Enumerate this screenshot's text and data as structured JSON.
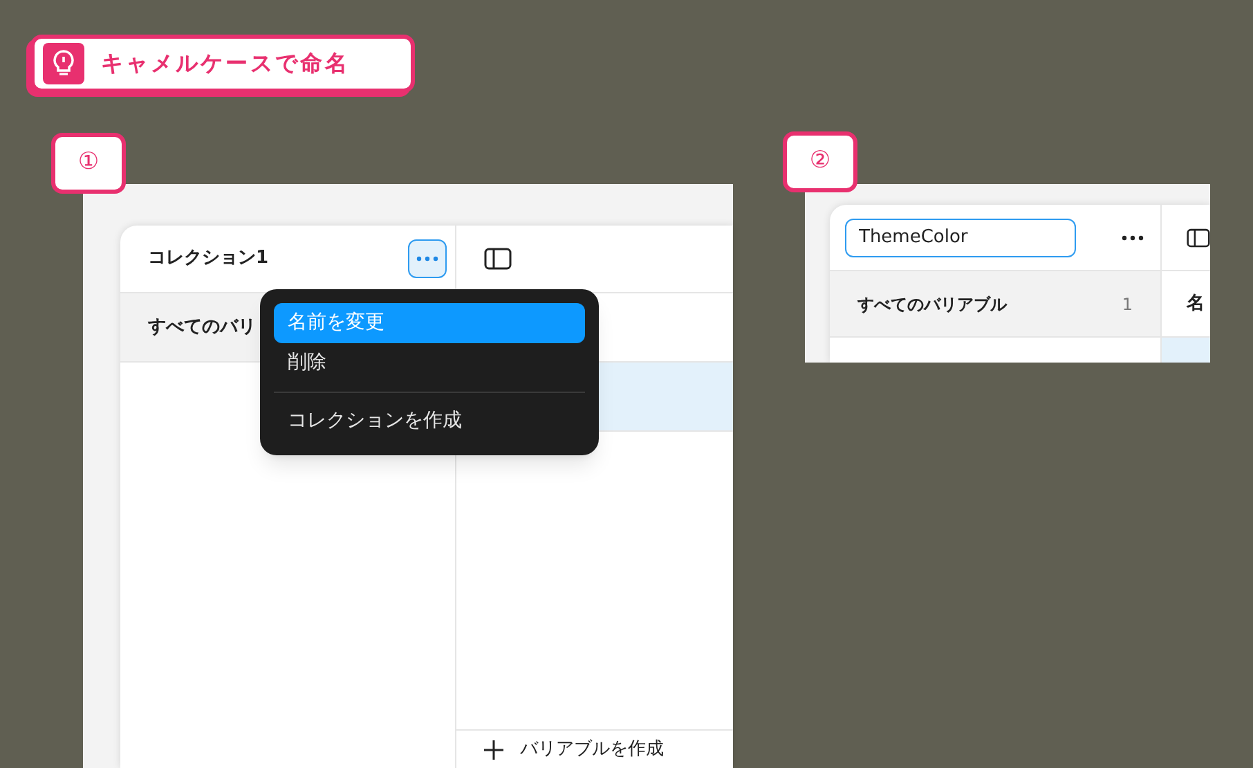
{
  "tip": {
    "title": "キャメルケースで命名"
  },
  "step1": {
    "badge": "①",
    "collection_title": "コレクション1",
    "more_button": {
      "active": true
    },
    "sidebar_items": [
      {
        "label": "すべてのバリ",
        "selected": true
      }
    ],
    "rows": [
      {
        "selected": false
      },
      {
        "selected": true
      }
    ],
    "menu": {
      "groups": [
        [
          {
            "label": "名前を変更",
            "selected": true
          },
          {
            "label": "削除",
            "selected": false
          }
        ],
        [
          {
            "label": "コレクションを作成",
            "selected": false
          }
        ]
      ]
    },
    "create_variable": "バリアブルを作成"
  },
  "step2": {
    "badge": "②",
    "name_input": {
      "value": "ThemeColor"
    },
    "more_button": {
      "active": false
    },
    "sidebar_items": [
      {
        "label": "すべてのバリアブル",
        "count": "1",
        "selected": true
      }
    ],
    "column_1": "名",
    "rows": [
      {
        "selected": true
      }
    ]
  }
}
